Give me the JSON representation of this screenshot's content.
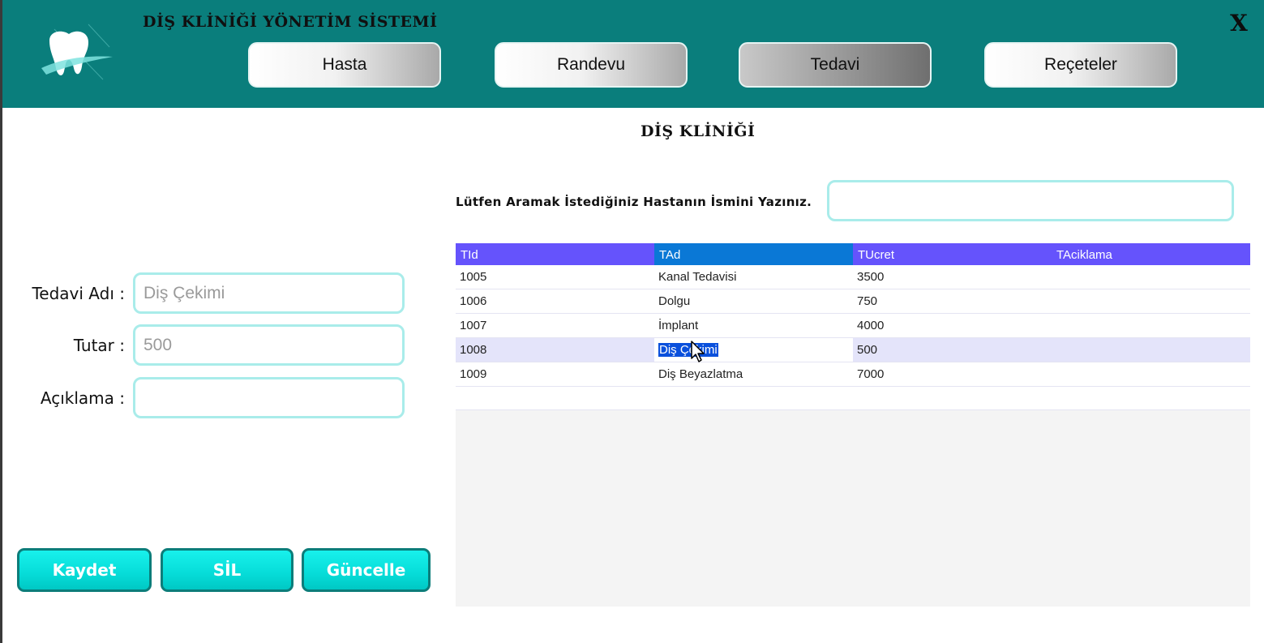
{
  "header": {
    "app_title": "DİŞ KLİNİĞİ YÖNETİM SİSTEMİ",
    "close_label": "X",
    "nav": [
      {
        "label": "Hasta",
        "active": false
      },
      {
        "label": "Randevu",
        "active": false
      },
      {
        "label": "Tedavi",
        "active": true
      },
      {
        "label": "Reçeteler",
        "active": false
      }
    ],
    "colors": {
      "header_bg": "#0a7e7c",
      "accent": "#06dcd8",
      "grid_header": "#6553fc"
    }
  },
  "page": {
    "heading": "DİŞ KLİNİĞİ"
  },
  "form": {
    "treatment_name_label": "Tedavi Adı :",
    "treatment_name_value": "Diş Çekimi",
    "amount_label": "Tutar :",
    "amount_value": "500",
    "description_label": "Açıklama :",
    "description_value": ""
  },
  "actions": {
    "save": "Kaydet",
    "delete": "SİL",
    "update": "Güncelle"
  },
  "search": {
    "label": "Lütfen Aramak İstediğiniz Hastanın İsmini Yazınız.",
    "value": ""
  },
  "grid": {
    "columns": [
      "TId",
      "TAd",
      "TUcret",
      "TAciklama"
    ],
    "rows": [
      [
        "1005",
        "Kanal Tedavisi",
        "3500",
        ""
      ],
      [
        "1006",
        "Dolgu",
        "750",
        ""
      ],
      [
        "1007",
        "İmplant",
        "4000",
        ""
      ],
      [
        "1008",
        "Diş Çekimi",
        "500",
        ""
      ],
      [
        "1009",
        "Diş Beyazlatma",
        "7000",
        ""
      ]
    ],
    "selected_row": 3
  }
}
